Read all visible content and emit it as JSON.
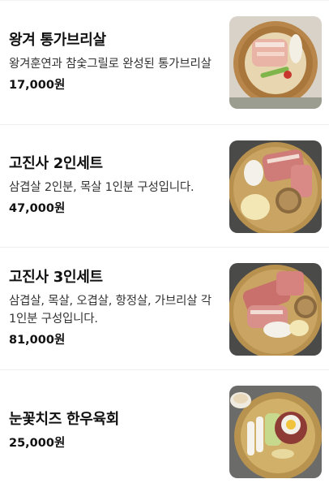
{
  "menu": {
    "items": [
      {
        "name": "왕겨 통가브리살",
        "description": "왕겨훈연과 참숯그릴로 완성된 통가브리살",
        "price": "17,000원",
        "image_icon": "pork-platter-image"
      },
      {
        "name": "고진사 2인세트",
        "description": "삼겹살 2인분, 목살 1인분 구성입니다.",
        "price": "47,000원",
        "image_icon": "pork-set-image"
      },
      {
        "name": "고진사 3인세트",
        "description": "삼겹살, 목살, 오겹살, 항정살, 가브리살 각 1인분 구성입니다.",
        "price": "81,000원",
        "image_icon": "pork-set-large-image"
      },
      {
        "name": "눈꽃치즈 한우육회",
        "description": "",
        "price": "25,000원",
        "image_icon": "beef-tartare-image"
      }
    ]
  }
}
